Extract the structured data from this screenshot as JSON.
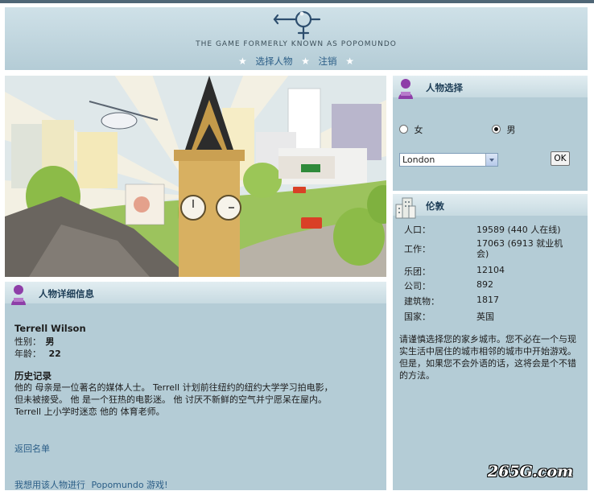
{
  "header": {
    "tagline": "THE GAME FORMERLY KNOWN AS POPOMUNDO",
    "nav": [
      {
        "label": "选择人物"
      },
      {
        "label": "注销"
      }
    ]
  },
  "character_panel": {
    "title": "人物详细信息",
    "name": "Terrell Wilson",
    "gender_label": "性别：",
    "gender_value": "男",
    "age_label": "年龄：",
    "age_value": "22",
    "history_title": "历史记录",
    "history_lines": [
      "他的 母亲是一位著名的媒体人士。 Terrell 计划前往纽约的纽约大学学习拍电影，",
      "但未被接受。 他 是一个狂热的电影迷。 他 讨厌不新鲜的空气并宁愿呆在屋内。",
      "Terrell 上小学时迷恋 他的 体育老师。"
    ],
    "back_link": "返回名单",
    "play_prefix": "我想用该人物进行",
    "play_link": "Popomundo 游戏",
    "play_suffix": "!"
  },
  "selection_panel": {
    "title": "人物选择",
    "female_label": "女",
    "male_label": "男",
    "selected_gender": "male",
    "city_value": "London",
    "ok_label": "OK"
  },
  "city_panel": {
    "title": "伦敦",
    "stats": [
      {
        "label": "人口：",
        "value": "19589 (440 人在线)"
      },
      {
        "label": "工作：",
        "value": "17063 (6913 就业机会)"
      },
      {
        "label": "乐团：",
        "value": "12104"
      },
      {
        "label": "公司：",
        "value": "892"
      },
      {
        "label": "建筑物：",
        "value": "1817"
      },
      {
        "label": "国家：",
        "value": "英国"
      }
    ],
    "note": "请谨慎选择您的家乡城市。您不必在一个与现实生活中居住的城市相邻的城市中开始游戏。但是，如果您不会外语的话，这将会是个不错的方法。"
  },
  "watermark": "265G.com",
  "colors": {
    "panel_bg": "#b4ccd6",
    "header_bg": "#cfe1e8",
    "link": "#2a5d86",
    "title": "#1e3e57"
  }
}
